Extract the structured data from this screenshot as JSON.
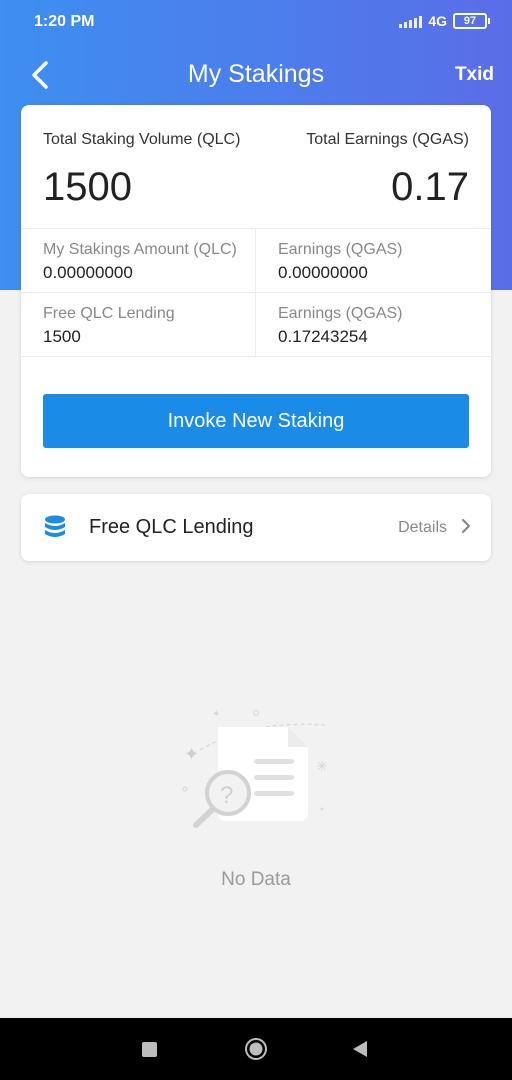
{
  "status": {
    "time": "1:20 PM",
    "network": "4G",
    "battery": "97"
  },
  "nav": {
    "title": "My Stakings",
    "txid_label": "Txid"
  },
  "summary": {
    "total_volume_label": "Total Staking Volume (QLC)",
    "total_volume_value": "1500",
    "total_earnings_label": "Total Earnings (QGAS)",
    "total_earnings_value": "0.17",
    "rows": [
      {
        "left_label": "My Stakings Amount (QLC)",
        "left_value": "0.00000000",
        "right_label": "Earnings (QGAS)",
        "right_value": "0.00000000"
      },
      {
        "left_label": "Free QLC Lending",
        "left_value": "1500",
        "right_label": "Earnings (QGAS)",
        "right_value": "0.17243254"
      }
    ],
    "invoke_button": "Invoke New Staking"
  },
  "lending": {
    "title": "Free QLC Lending",
    "details_label": "Details",
    "icon": "database-icon",
    "accent": "#1a8ce8"
  },
  "empty": {
    "message": "No Data"
  }
}
